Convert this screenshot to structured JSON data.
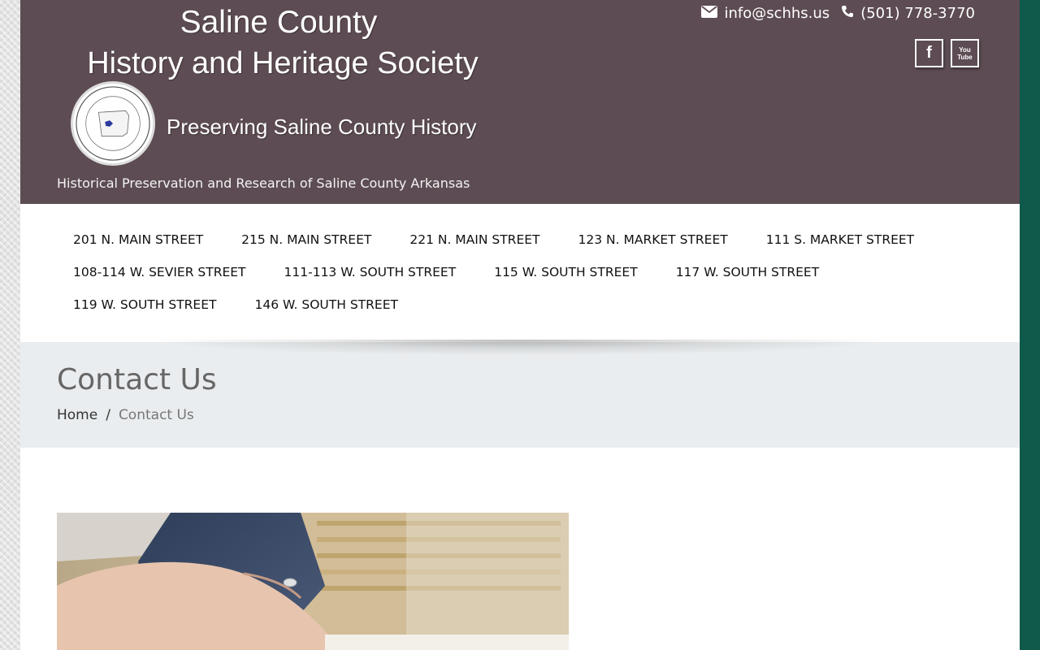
{
  "header": {
    "logo_line1": "Saline County",
    "logo_line2": "History and Heritage Society",
    "logo_tagline": "Preserving Saline County History",
    "site_description": "Historical Preservation and Research of Saline County Arkansas",
    "email": "info@schhs.us",
    "phone": "(501) 778-3770",
    "social": {
      "facebook": "f",
      "youtube": "You Tube"
    },
    "colors": {
      "header_bg": "#5d4c53",
      "side_strip": "#0f5a4a"
    }
  },
  "nav": {
    "items": [
      "201 N. MAIN STREET",
      "215 N. MAIN STREET",
      "221 N. MAIN STREET",
      "123 N. MARKET STREET",
      "111 S. MARKET STREET",
      "108-114 W. SEVIER STREET",
      "111-113 W. SOUTH STREET",
      "115 W. SOUTH STREET",
      "117 W. SOUTH STREET",
      "119 W. SOUTH STREET",
      "146 W. SOUTH STREET"
    ]
  },
  "page": {
    "title": "Contact Us",
    "breadcrumb": {
      "home": "Home",
      "separator": "/",
      "current": "Contact Us"
    }
  },
  "icons": {
    "email": "envelope-icon",
    "phone": "phone-icon",
    "facebook": "facebook-icon",
    "youtube": "youtube-icon"
  }
}
